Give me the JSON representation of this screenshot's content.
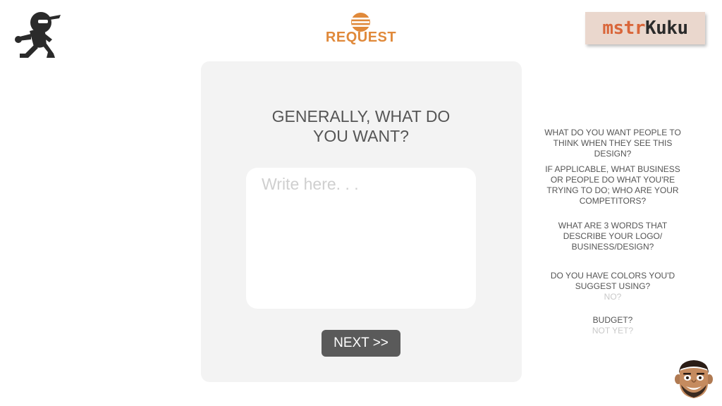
{
  "header": {
    "title": "REQUEST",
    "brand": {
      "part1": "mstr",
      "part2": "Kuku"
    }
  },
  "main": {
    "question": "GENERALLY, WHAT DO YOU WANT?",
    "input_placeholder": "Write here. . .",
    "next_label": "NEXT >>"
  },
  "sidebar": {
    "q1": "WHAT DO YOU WANT PEOPLE TO THINK WHEN THEY SEE THIS DESIGN?",
    "q2": "IF APPLICABLE, WHAT BUSINESS OR PEOPLE DO WHAT YOU'RE TRYING TO DO; WHO ARE YOUR COMPETITORS?",
    "q3": "WHAT ARE 3 WORDS THAT DESCRIBE YOUR LOGO/ BUSINESS/DESIGN?",
    "q4": "DO YOU HAVE COLORS YOU'D SUGGEST USING?",
    "q4_hint": "NO?",
    "q5": "BUDGET?",
    "q5_hint": "NOT YET?"
  },
  "icons": {
    "logo": "ninja-runner-icon",
    "request": "striped-circle-icon",
    "avatar": "cartoon-face-avatar"
  },
  "colors": {
    "accent": "#e0893a",
    "card_bg": "#f3f3f3",
    "button_bg": "#5a5a5a",
    "brand_bg": "#ead7cd"
  }
}
